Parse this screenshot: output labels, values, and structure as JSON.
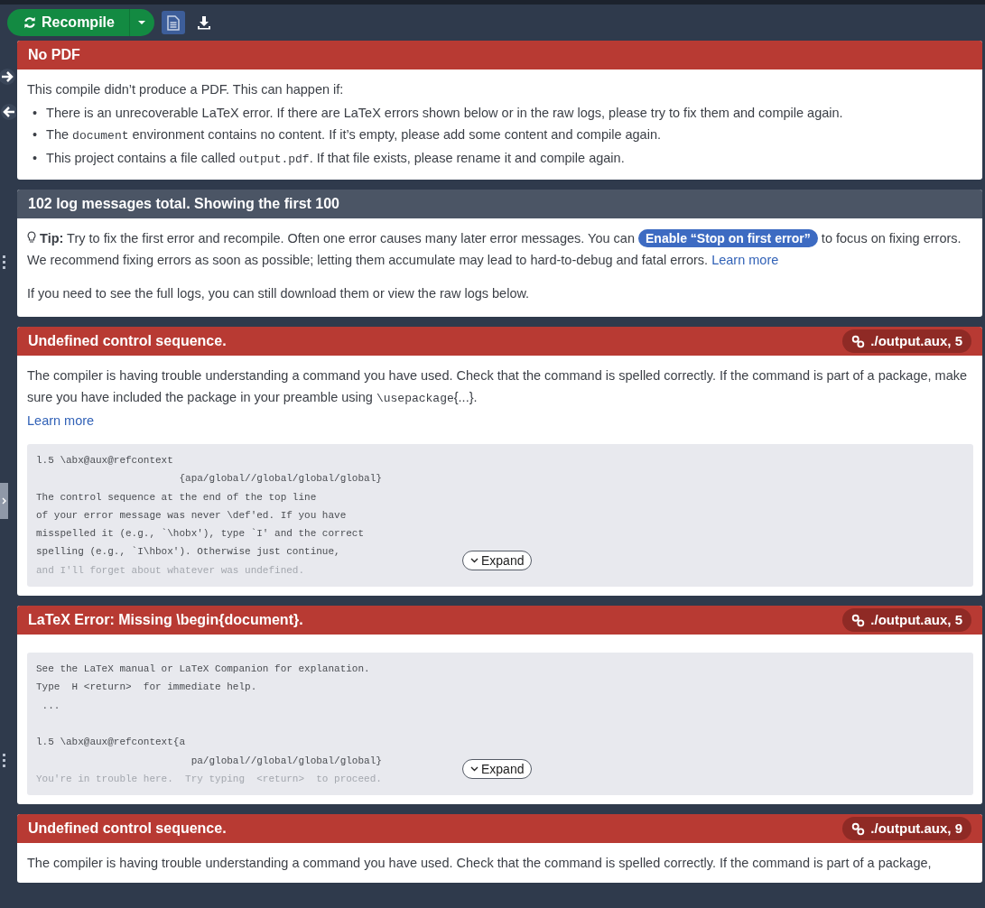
{
  "toolbar": {
    "recompile_label": "Recompile",
    "pdf_view_selected": true
  },
  "panels": [
    {
      "kind": "error",
      "title": "No PDF",
      "intro": "This compile didn’t produce a PDF. This can happen if:",
      "bullets": [
        {
          "marker": "•",
          "segments": [
            {
              "text": "There is an unrecoverable LaTeX error. If there are LaTeX errors shown below or in the raw logs, please try to fix them and compile again."
            }
          ]
        },
        {
          "marker": "•",
          "segments": [
            {
              "text": "The "
            },
            {
              "text": "document",
              "kind": "code"
            },
            {
              "text": " environment contains no content. If it’s empty, please add some content and compile again."
            }
          ]
        },
        {
          "marker": "•",
          "segments": [
            {
              "text": "This project contains a file called "
            },
            {
              "text": "output.pdf",
              "kind": "code"
            },
            {
              "text": ". If that file exists, please rename it and compile again."
            }
          ]
        }
      ]
    },
    {
      "kind": "summary",
      "title": "102 log messages total. Showing the first 100",
      "tip_label": "Tip:",
      "tip_before": "Try to fix the first error and recompile. Often one error causes many later error messages. You can",
      "tip_button": "Enable “Stop on first error”",
      "tip_after": "to focus on fixing errors. We recommend fixing errors as soon as possible; letting them accumulate may lead to hard-to-debug and fatal errors.",
      "tip_link": "Learn more",
      "note": "If you need to see the full logs, you can still download them or view the raw logs below."
    },
    {
      "kind": "log",
      "title": "Undefined control sequence.",
      "location": "./output.aux, 5",
      "description": [
        {
          "text": "The compiler is having trouble understanding a command you have used. Check that the command is spelled correctly. If the command is part of a package, make sure you have included the package in your preamble using "
        },
        {
          "text": "\\usepackage",
          "kind": "code"
        },
        {
          "text": "{...}."
        }
      ],
      "learn_more": "Learn more",
      "log_lines": [
        {
          "text": "l.5 \\abx@aux@refcontext",
          "faded": false
        },
        {
          "text": "                        {apa/global//global/global/global}",
          "faded": false
        },
        {
          "text": "The control sequence at the end of the top line",
          "faded": false
        },
        {
          "text": "of your error message was never \\def'ed. If you have",
          "faded": false
        },
        {
          "text": "misspelled it (e.g., `\\hobx'), type `I' and the correct",
          "faded": false
        },
        {
          "text": "spelling (e.g., `I\\hbox'). Otherwise just continue,",
          "faded": false
        },
        {
          "text": "and I'll forget about whatever was undefined.",
          "faded": true
        }
      ],
      "expand_label": "Expand"
    },
    {
      "kind": "log",
      "title": "LaTeX Error: Missing \\begin{document}.",
      "location": "./output.aux, 5",
      "log_lines": [
        {
          "text": "See the LaTeX manual or LaTeX Companion for explanation.",
          "faded": false
        },
        {
          "text": "Type  H <return>  for immediate help.",
          "faded": false
        },
        {
          "text": " ...",
          "faded": false
        },
        {
          "text": "l.5 \\abx@aux@refcontext{a",
          "faded": false,
          "gap_before": true
        },
        {
          "text": "                          pa/global//global/global/global}",
          "faded": false
        },
        {
          "text": "You're in trouble here.  Try typing  <return>  to proceed.",
          "faded": true
        }
      ],
      "expand_label": "Expand"
    },
    {
      "kind": "log",
      "title": "Undefined control sequence.",
      "location": "./output.aux, 9",
      "description": [
        {
          "text": "The compiler is having trouble understanding a command you have used. Check that the command is spelled correctly. If the command is part of a package,"
        }
      ]
    }
  ]
}
